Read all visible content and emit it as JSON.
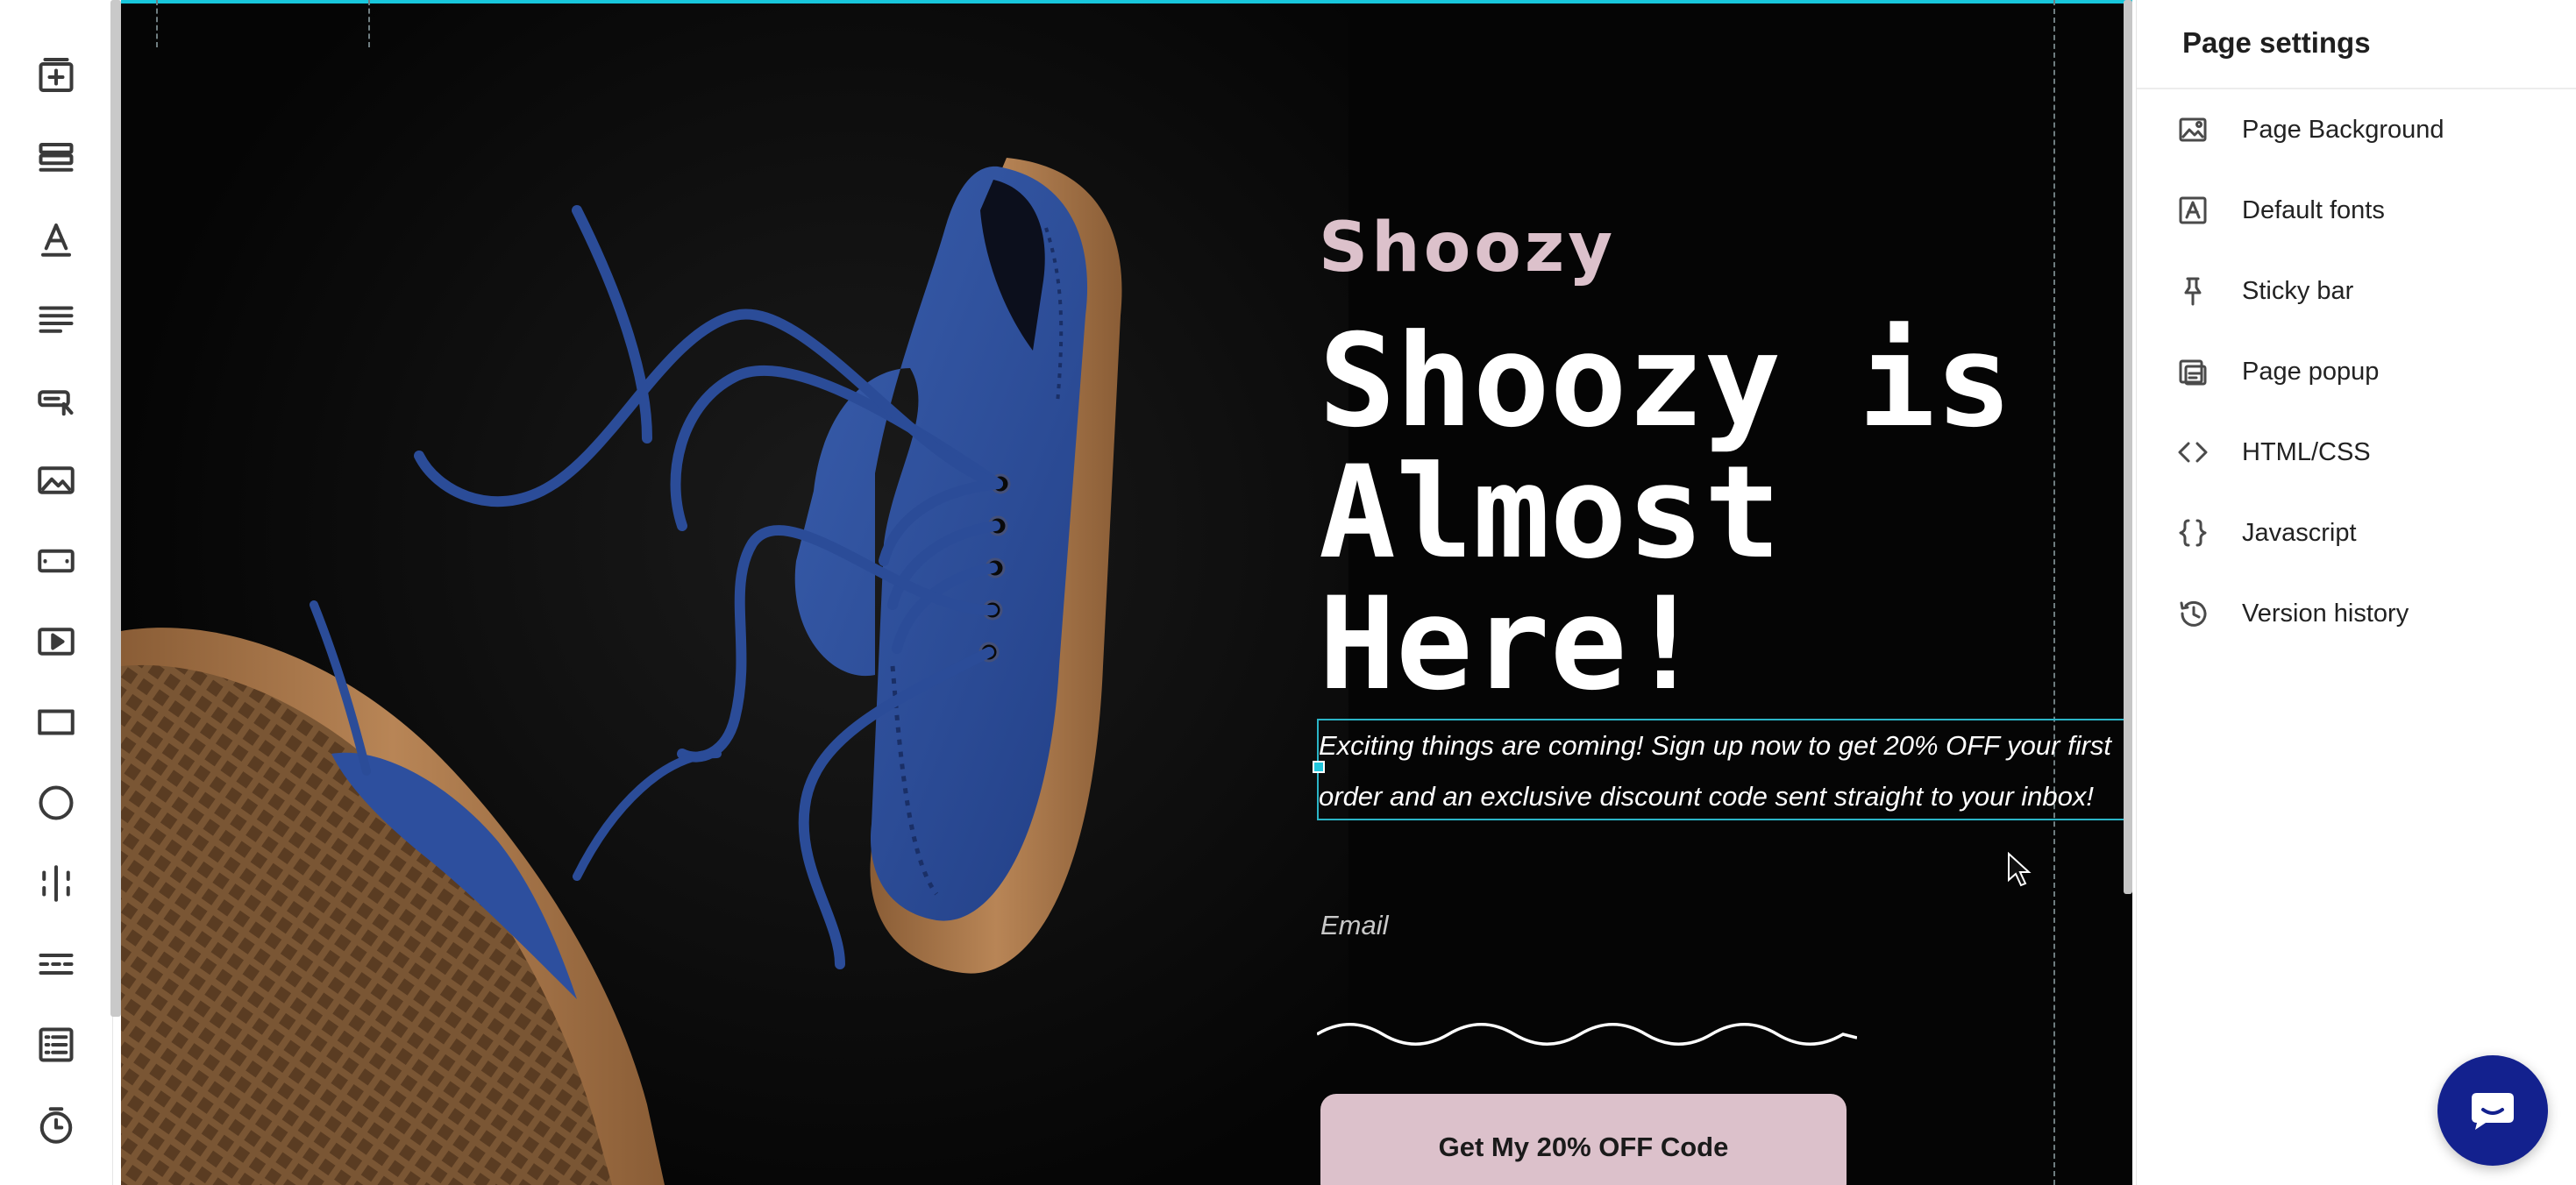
{
  "rail": {
    "tools": [
      {
        "name": "add-section-icon"
      },
      {
        "name": "rows-icon"
      },
      {
        "name": "text-icon"
      },
      {
        "name": "paragraph-icon"
      },
      {
        "name": "button-icon"
      },
      {
        "name": "image-icon"
      },
      {
        "name": "form-field-icon"
      },
      {
        "name": "video-icon"
      },
      {
        "name": "rectangle-icon"
      },
      {
        "name": "circle-icon"
      },
      {
        "name": "columns-icon"
      },
      {
        "name": "divider-icon"
      },
      {
        "name": "list-form-icon"
      },
      {
        "name": "timer-icon"
      }
    ]
  },
  "canvas": {
    "brand": "Shoozy",
    "headline": "Shoozy is Almost Here!",
    "description": "Exciting things are coming! Sign up now to get 20% OFF your first order and an exclusive discount code sent straight to your inbox!",
    "email_label": "Email",
    "cta_label": "Get My 20% OFF Code",
    "colors": {
      "background": "#050505",
      "accent_pink": "#dcc1cb",
      "selection": "#2bb4c6",
      "shoe_blue": "#2d4f9e",
      "sole_brown": "#a8784a"
    }
  },
  "panel": {
    "title": "Page settings",
    "items": [
      {
        "label": "Page Background",
        "icon": "image-icon"
      },
      {
        "label": "Default fonts",
        "icon": "font-icon"
      },
      {
        "label": "Sticky bar",
        "icon": "pin-icon"
      },
      {
        "label": "Page popup",
        "icon": "popup-icon"
      },
      {
        "label": "HTML/CSS",
        "icon": "code-icon"
      },
      {
        "label": "Javascript",
        "icon": "braces-icon"
      },
      {
        "label": "Version history",
        "icon": "history-icon"
      }
    ]
  },
  "chat": {
    "icon": "chat-bubble-icon",
    "color": "#13218e"
  }
}
